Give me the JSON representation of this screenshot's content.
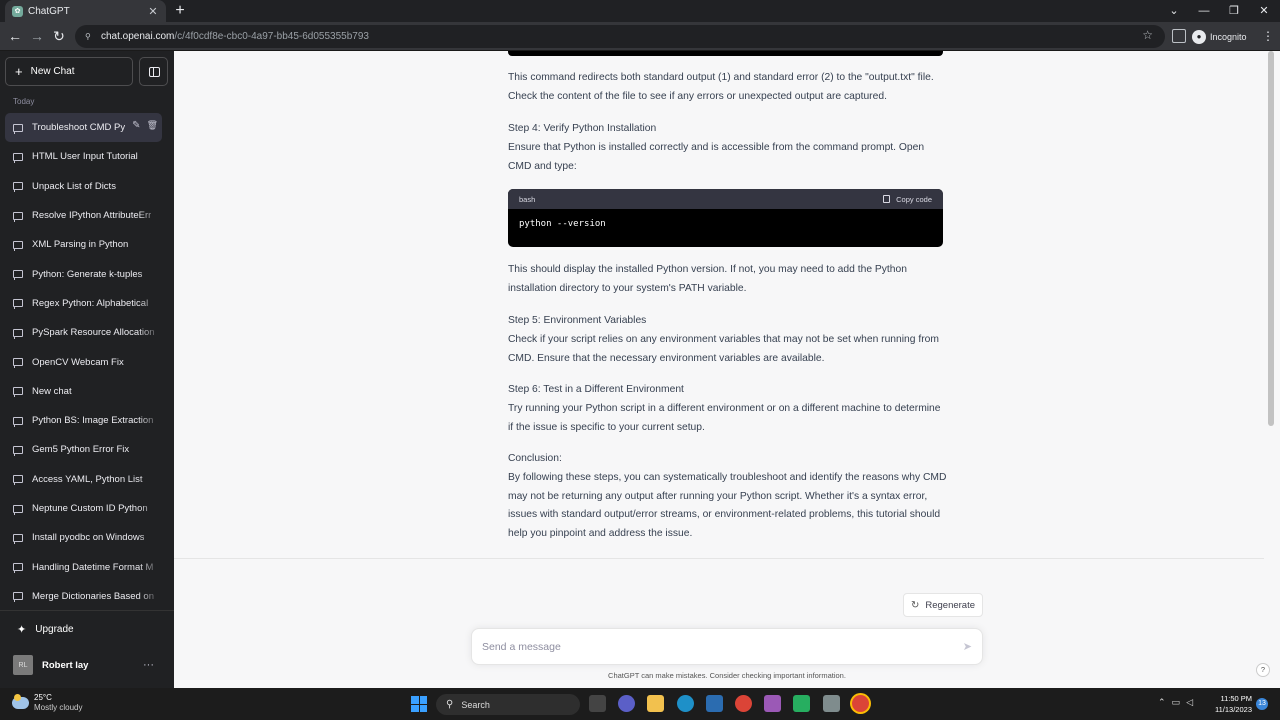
{
  "browser": {
    "tab_title": "ChatGPT",
    "tab_close": "✕",
    "new_tab": "+",
    "url_host": "chat.openai.com",
    "url_path": "/c/4f0cdf8e-cbc0-4a97-bb45-6d055355b793",
    "incognito_label": "Incognito",
    "window_controls": [
      "⌄",
      "—",
      "❐",
      "✕"
    ]
  },
  "sidebar": {
    "new_chat_label": "New Chat",
    "section_label": "Today",
    "chats": [
      "Troubleshoot CMD Py",
      "HTML User Input Tutorial",
      "Unpack List of Dicts",
      "Resolve IPython AttributeErr",
      "XML Parsing in Python",
      "Python: Generate k-tuples",
      "Regex Python: Alphabetical",
      "PySpark Resource Allocation",
      "OpenCV Webcam Fix",
      "New chat",
      "Python BS: Image Extraction",
      "Gem5 Python Error Fix",
      "Access YAML, Python List",
      "Neptune Custom ID Python",
      "Install pyodbc on Windows",
      "Handling Datetime Format M",
      "Merge Dictionaries Based on"
    ],
    "upgrade_label": "Upgrade",
    "user_initials": "RL",
    "user_name": "Robert lay",
    "user_menu": "···"
  },
  "message": {
    "p1": "This command redirects both standard output (1) and standard error (2) to the \"output.txt\" file. Check the content of the file to see if any errors or unexpected output are captured.",
    "step4_title": "Step 4: Verify Python Installation",
    "step4_body": "Ensure that Python is installed correctly and is accessible from the command prompt. Open CMD and type:",
    "code_lang": "bash",
    "copy_label": "Copy code",
    "code": "python --version",
    "p2": "This should display the installed Python version. If not, you may need to add the Python installation directory to your system's PATH variable.",
    "step5_title": "Step 5: Environment Variables",
    "step5_body": "Check if your script relies on any environment variables that may not be set when running from CMD. Ensure that the necessary environment variables are available.",
    "step6_title": "Step 6: Test in a Different Environment",
    "step6_body": "Try running your Python script in a different environment or on a different machine to determine if the issue is specific to your current setup.",
    "conclusion_title": "Conclusion:",
    "conclusion_body": "By following these steps, you can systematically troubleshoot and identify the reasons why CMD may not be returning any output after running your Python script. Whether it's a syntax error, issues with standard output/error streams, or environment-related problems, this tutorial should help you pinpoint and address the issue."
  },
  "composer": {
    "regenerate_label": "Regenerate",
    "placeholder": "Send a message",
    "disclaimer": "ChatGPT can make mistakes. Consider checking important information.",
    "help": "?"
  },
  "taskbar": {
    "temperature": "25°C",
    "weather": "Mostly cloudy",
    "search_label": "Search",
    "time": "11:50 PM",
    "date": "11/13/2023",
    "notification_count": "13"
  },
  "colors": {
    "sidebar_bg": "#202123",
    "main_bg": "#f7f7f8",
    "code_bg": "#000000",
    "accent": "#74aa9c"
  }
}
